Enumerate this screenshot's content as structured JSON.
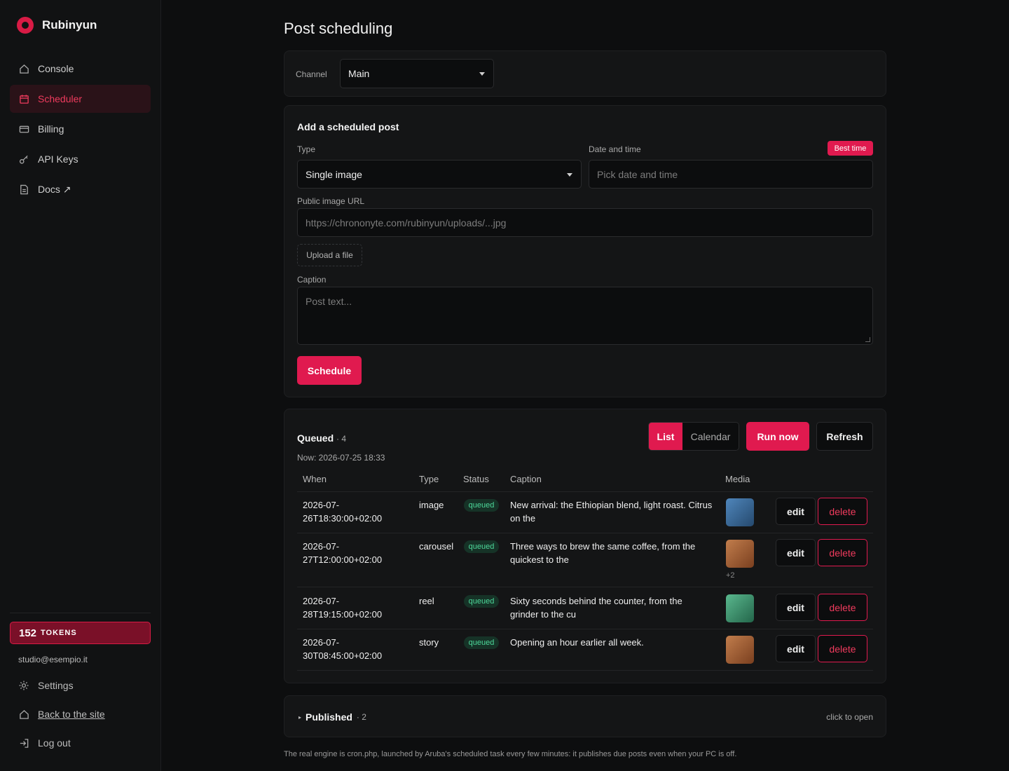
{
  "brand": {
    "name": "Rubinyun",
    "accent": "#e01a4f"
  },
  "nav": [
    {
      "label": "Console",
      "icon": "home-icon"
    },
    {
      "label": "Scheduler",
      "icon": "calendar-icon"
    },
    {
      "label": "Billing",
      "icon": "card-icon"
    },
    {
      "label": "API Keys",
      "icon": "key-icon"
    },
    {
      "label": "Docs ↗",
      "icon": "doc-icon"
    }
  ],
  "tokens": {
    "count": "152",
    "label": "TOKENS"
  },
  "user": {
    "email": "studio@esempio.it"
  },
  "side_links": {
    "settings": "Settings",
    "back": "Back to the site",
    "logout": "Log out"
  },
  "page": {
    "title": "Post scheduling"
  },
  "channel": {
    "label": "Channel",
    "value": "Main"
  },
  "add_post": {
    "title": "Add a scheduled post",
    "type_label": "Type",
    "type_value": "Single image",
    "datetime_label": "Date and time",
    "best_time": "Best time",
    "datetime_placeholder": "Pick date and time",
    "url_label": "Public image URL",
    "url_placeholder": "https://chrononyte.com/rubinyun/uploads/...jpg",
    "upload": "Upload a file",
    "caption_label": "Caption",
    "caption_placeholder": "Post text...",
    "schedule": "Schedule"
  },
  "queued": {
    "title": "Queued",
    "count": "· 4",
    "now": "Now: 2026-07-25 18:33",
    "view_list": "List",
    "view_calendar": "Calendar",
    "run_now": "Run now",
    "refresh": "Refresh",
    "columns": {
      "when": "When",
      "type": "Type",
      "status": "Status",
      "caption": "Caption",
      "media": "Media"
    },
    "rows": [
      {
        "when_1": "2026-07-",
        "when_2": "26T18:30:00+02:00",
        "type": "image",
        "status": "queued",
        "caption_1": "New arrival: the Ethiopian blend, light roast. Citrus",
        "caption_2": "on the",
        "extra": "",
        "edit": "edit",
        "delete": "delete",
        "thumb_color": "#3a6b9c"
      },
      {
        "when_1": "2026-07-",
        "when_2": "27T12:00:00+02:00",
        "type": "carousel",
        "status": "queued",
        "caption_1": "Three ways to brew the same coffee, from the",
        "caption_2": "quickest to the",
        "extra": "+2",
        "edit": "edit",
        "delete": "delete",
        "thumb_color": "#a8663c"
      },
      {
        "when_1": "2026-07-",
        "when_2": "28T19:15:00+02:00",
        "type": "reel",
        "status": "queued",
        "caption_1": "Sixty seconds behind the counter, from the",
        "caption_2": "grinder to the cu",
        "extra": "",
        "edit": "edit",
        "delete": "delete",
        "thumb_color": "#3f9a72"
      },
      {
        "when_1": "2026-07-",
        "when_2": "30T08:45:00+02:00",
        "type": "story",
        "status": "queued",
        "caption_1": "Opening an hour earlier all week.",
        "caption_2": "",
        "extra": "",
        "edit": "edit",
        "delete": "delete",
        "thumb_color": "#a8663c"
      }
    ]
  },
  "published": {
    "title": "Published",
    "count": "· 2",
    "hint": "click to open"
  },
  "footer": {
    "note": "The real engine is cron.php, launched by Aruba's scheduled task every few minutes: it publishes due posts even when your PC is off."
  }
}
